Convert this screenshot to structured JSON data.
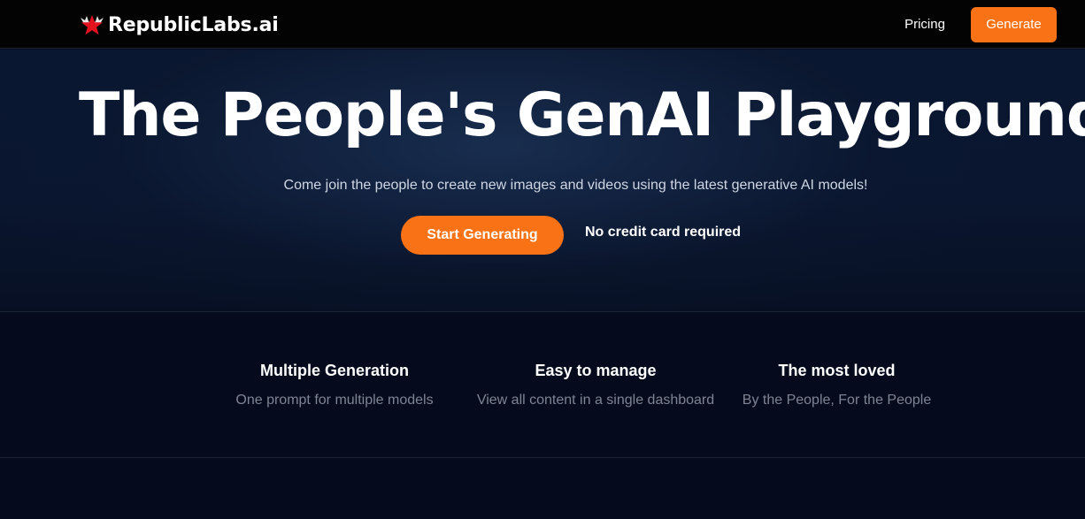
{
  "colors": {
    "accent": "#f97316",
    "background": "#050b1c",
    "navbar": "#030303"
  },
  "navbar": {
    "brand_name": "RepublicLabs.ai",
    "logo_icon": "winged-red-star-logo",
    "pricing_label": "Pricing",
    "generate_label": "Generate"
  },
  "hero": {
    "title": "The People's GenAI Playground.",
    "subtitle": "Come join the people to create new images and videos using the latest generative AI models!",
    "cta_label": "Start Generating",
    "cta_note": "No credit card required"
  },
  "features": [
    {
      "title": "Multiple Generation",
      "description": "One prompt for multiple models"
    },
    {
      "title": "Easy to manage",
      "description": "View all content in a single dashboard"
    },
    {
      "title": "The most loved",
      "description": "By the People, For the People"
    }
  ]
}
